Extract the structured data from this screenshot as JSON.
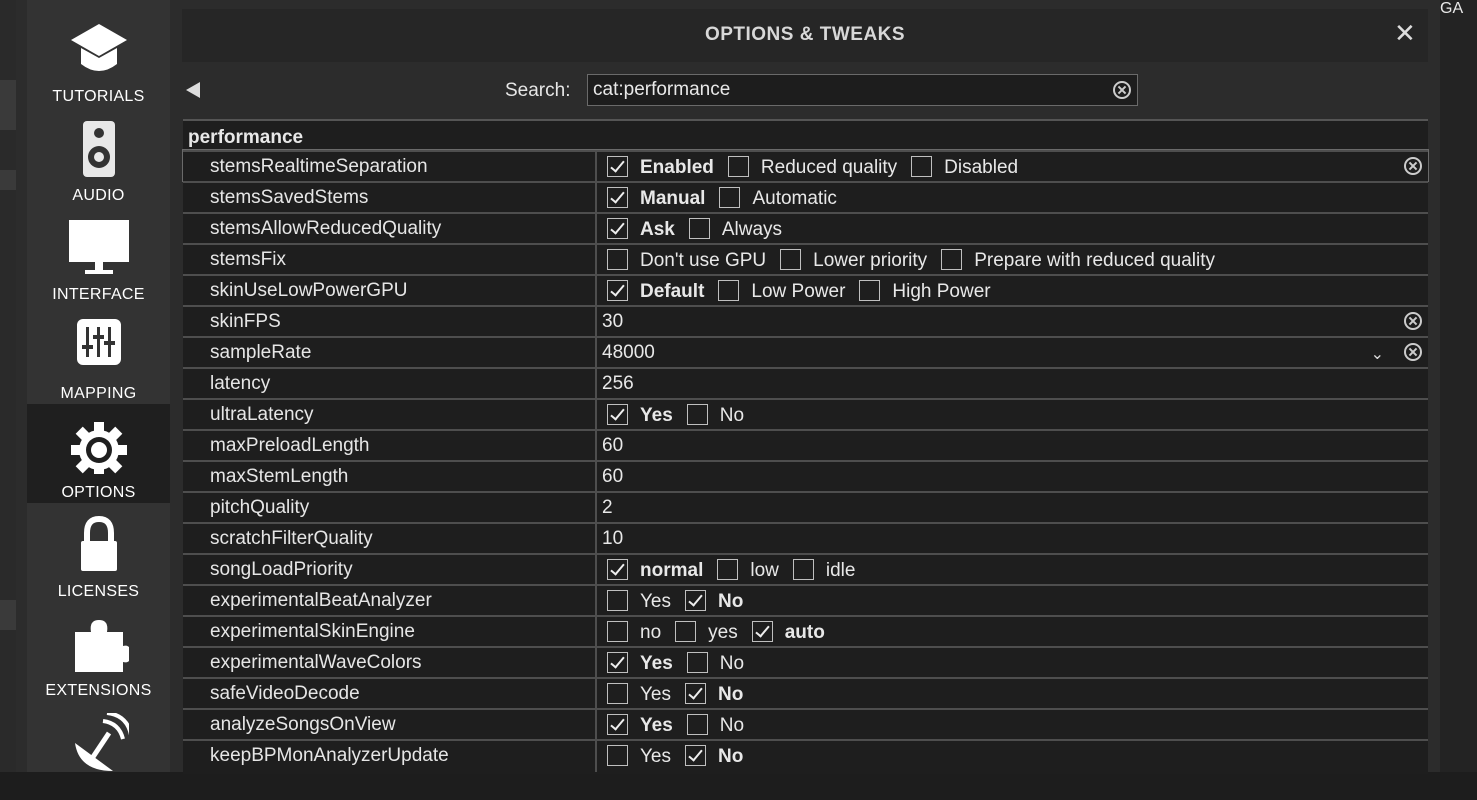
{
  "sidebar": {
    "items": [
      {
        "label": "TUTORIALS",
        "icon": "graduation-cap-icon"
      },
      {
        "label": "AUDIO",
        "icon": "speaker-icon"
      },
      {
        "label": "INTERFACE",
        "icon": "monitor-icon"
      },
      {
        "label": "MAPPING",
        "icon": "sliders-icon"
      },
      {
        "label": "OPTIONS",
        "icon": "gear-icon",
        "active": true
      },
      {
        "label": "LICENSES",
        "icon": "lock-icon"
      },
      {
        "label": "EXTENSIONS",
        "icon": "puzzle-icon"
      },
      {
        "label": "",
        "icon": "satellite-dish-icon"
      }
    ]
  },
  "header": {
    "title": "OPTIONS & TWEAKS",
    "close": "✕"
  },
  "search": {
    "label": "Search:",
    "value": "cat:performance"
  },
  "section": "performance",
  "rows": [
    {
      "name": "stemsRealtimeSeparation",
      "options": [
        {
          "label": "Enabled",
          "checked": true
        },
        {
          "label": "Reduced quality",
          "checked": false
        },
        {
          "label": "Disabled",
          "checked": false
        }
      ],
      "clear": true,
      "selected": true
    },
    {
      "name": "stemsSavedStems",
      "options": [
        {
          "label": "Manual",
          "checked": true
        },
        {
          "label": "Automatic",
          "checked": false
        }
      ]
    },
    {
      "name": "stemsAllowReducedQuality",
      "options": [
        {
          "label": "Ask",
          "checked": true
        },
        {
          "label": "Always",
          "checked": false
        }
      ]
    },
    {
      "name": "stemsFix",
      "options": [
        {
          "label": "Don't use GPU",
          "checked": false
        },
        {
          "label": "Lower priority",
          "checked": false
        },
        {
          "label": "Prepare with reduced quality",
          "checked": false
        }
      ]
    },
    {
      "name": "skinUseLowPowerGPU",
      "options": [
        {
          "label": "Default",
          "checked": true
        },
        {
          "label": "Low Power",
          "checked": false
        },
        {
          "label": "High Power",
          "checked": false
        }
      ]
    },
    {
      "name": "skinFPS",
      "value": "30",
      "editing": true,
      "clear": true
    },
    {
      "name": "sampleRate",
      "value": "48000",
      "dropdown": true,
      "clear": true
    },
    {
      "name": "latency",
      "value": "256"
    },
    {
      "name": "ultraLatency",
      "options": [
        {
          "label": "Yes",
          "checked": true
        },
        {
          "label": "No",
          "checked": false
        }
      ]
    },
    {
      "name": "maxPreloadLength",
      "value": "60"
    },
    {
      "name": "maxStemLength",
      "value": "60"
    },
    {
      "name": "pitchQuality",
      "value": "2"
    },
    {
      "name": "scratchFilterQuality",
      "value": "10"
    },
    {
      "name": "songLoadPriority",
      "options": [
        {
          "label": "normal",
          "checked": true
        },
        {
          "label": "low",
          "checked": false
        },
        {
          "label": "idle",
          "checked": false
        }
      ]
    },
    {
      "name": "experimentalBeatAnalyzer",
      "options": [
        {
          "label": "Yes",
          "checked": false
        },
        {
          "label": "No",
          "checked": true
        }
      ]
    },
    {
      "name": "experimentalSkinEngine",
      "options": [
        {
          "label": "no",
          "checked": false
        },
        {
          "label": "yes",
          "checked": false
        },
        {
          "label": "auto",
          "checked": true
        }
      ]
    },
    {
      "name": "experimentalWaveColors",
      "options": [
        {
          "label": "Yes",
          "checked": true
        },
        {
          "label": "No",
          "checked": false
        }
      ]
    },
    {
      "name": "safeVideoDecode",
      "options": [
        {
          "label": "Yes",
          "checked": false
        },
        {
          "label": "No",
          "checked": true
        }
      ]
    },
    {
      "name": "analyzeSongsOnView",
      "options": [
        {
          "label": "Yes",
          "checked": true
        },
        {
          "label": "No",
          "checked": false
        }
      ]
    },
    {
      "name": "keepBPMonAnalyzerUpdate",
      "options": [
        {
          "label": "Yes",
          "checked": false
        },
        {
          "label": "No",
          "checked": true
        }
      ]
    }
  ],
  "background": {
    "badge_text": "GA"
  }
}
